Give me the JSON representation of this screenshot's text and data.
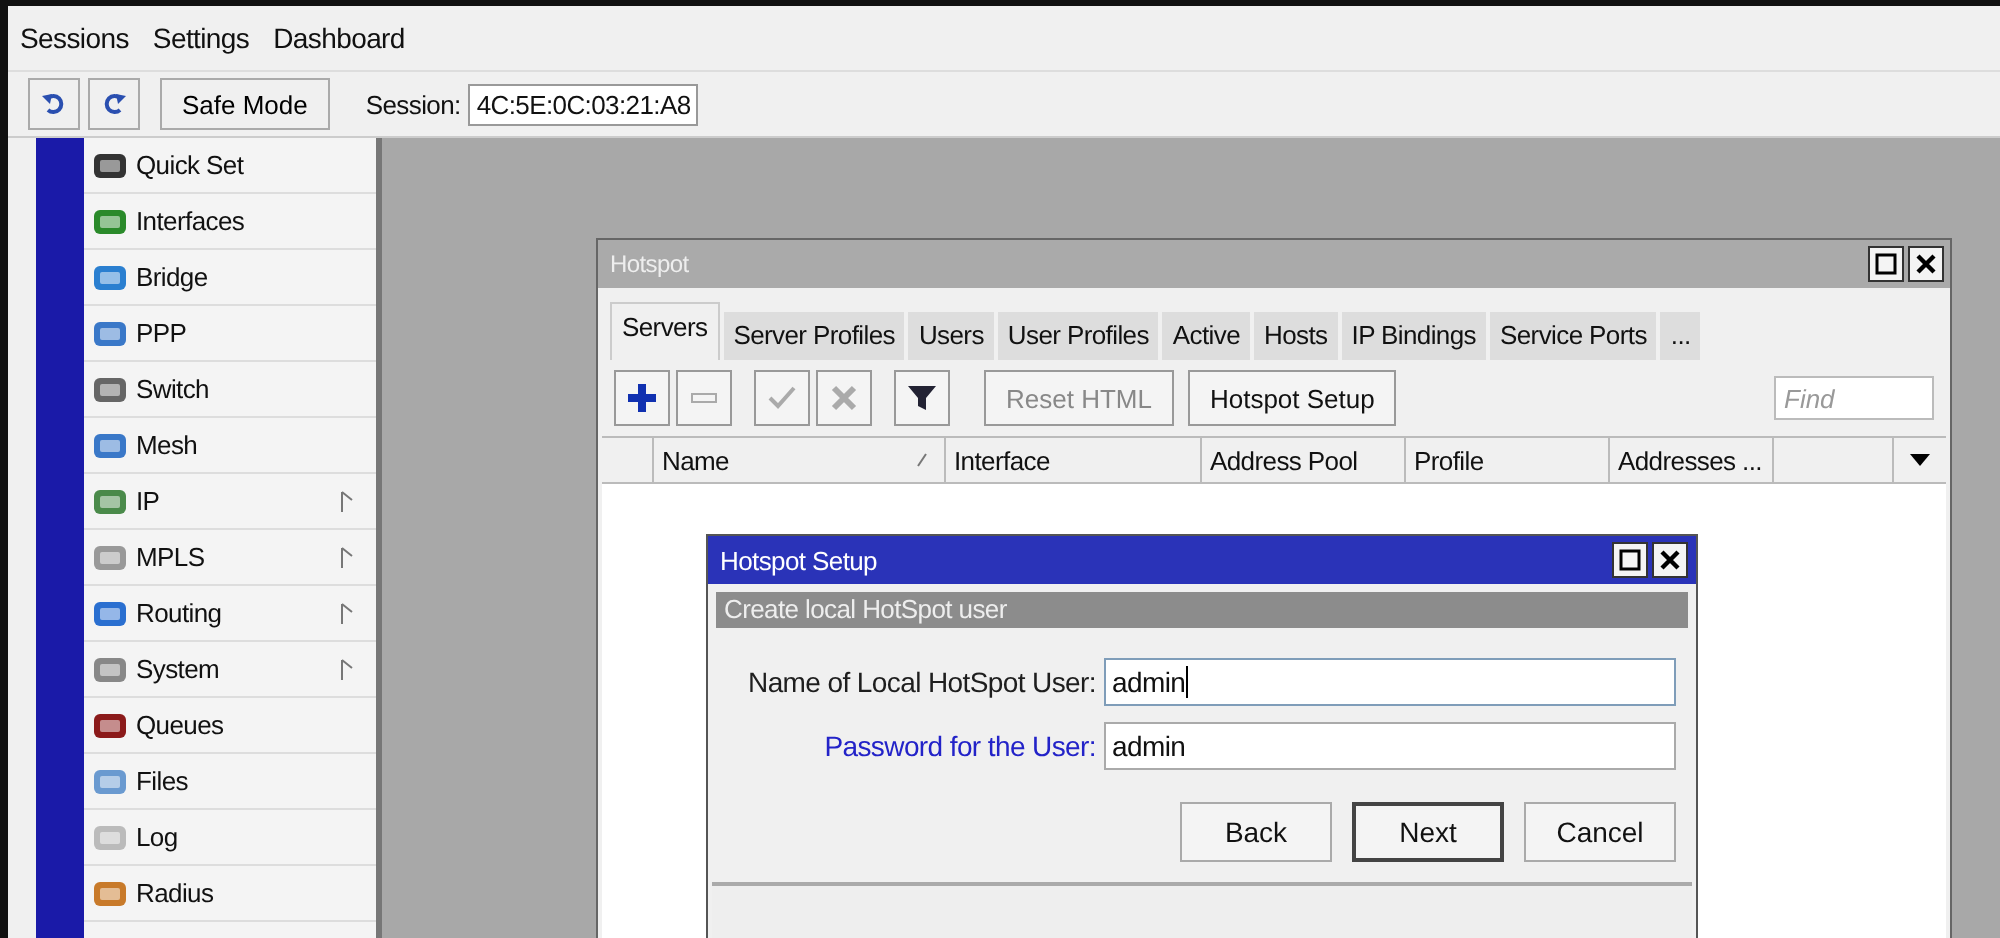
{
  "menu_bar": {
    "items": [
      "Sessions",
      "Settings",
      "Dashboard"
    ]
  },
  "toolbar": {
    "safe_mode": "Safe Mode",
    "session_label": "Session:",
    "session_value": "4C:5E:0C:03:21:A8"
  },
  "sidebar": {
    "items": [
      {
        "label": "Quick Set",
        "has_submenu": false
      },
      {
        "label": "Interfaces",
        "has_submenu": false
      },
      {
        "label": "Bridge",
        "has_submenu": false
      },
      {
        "label": "PPP",
        "has_submenu": false
      },
      {
        "label": "Switch",
        "has_submenu": false
      },
      {
        "label": "Mesh",
        "has_submenu": false
      },
      {
        "label": "IP",
        "has_submenu": true
      },
      {
        "label": "MPLS",
        "has_submenu": true
      },
      {
        "label": "Routing",
        "has_submenu": true
      },
      {
        "label": "System",
        "has_submenu": true
      },
      {
        "label": "Queues",
        "has_submenu": false
      },
      {
        "label": "Files",
        "has_submenu": false
      },
      {
        "label": "Log",
        "has_submenu": false
      },
      {
        "label": "Radius",
        "has_submenu": false
      }
    ]
  },
  "hotspot_window": {
    "title": "Hotspot",
    "tabs": [
      {
        "label": "Servers",
        "selected": true
      },
      {
        "label": "Server Profiles",
        "selected": false
      },
      {
        "label": "Users",
        "selected": false
      },
      {
        "label": "User Profiles",
        "selected": false
      },
      {
        "label": "Active",
        "selected": false
      },
      {
        "label": "Hosts",
        "selected": false
      },
      {
        "label": "IP Bindings",
        "selected": false
      },
      {
        "label": "Service Ports",
        "selected": false
      },
      {
        "label": "...",
        "selected": false
      }
    ],
    "tool_buttons": [
      {
        "kind": "add",
        "disabled": false
      },
      {
        "kind": "remove",
        "disabled": true
      },
      {
        "kind": "enable",
        "disabled": true
      },
      {
        "kind": "disable",
        "disabled": true
      },
      {
        "kind": "filter",
        "disabled": false
      }
    ],
    "text_buttons": [
      {
        "label": "Reset HTML",
        "disabled": true
      },
      {
        "label": "Hotspot Setup",
        "disabled": false
      }
    ],
    "find": {
      "placeholder": "Find"
    },
    "table": {
      "columns": [
        {
          "label": "Name",
          "sorted": true
        },
        {
          "label": "Interface",
          "sorted": false
        },
        {
          "label": "Address Pool",
          "sorted": false
        },
        {
          "label": "Profile",
          "sorted": false
        },
        {
          "label": "Addresses ...",
          "sorted": false
        }
      ]
    }
  },
  "setup_dialog": {
    "title": "Hotspot Setup",
    "subtitle": "Create local HotSpot user",
    "fields": [
      {
        "label": "Name of Local HotSpot User:",
        "value": "admin",
        "color": "#1e1e1e",
        "focused": true
      },
      {
        "label": "Password for the User:",
        "value": "admin",
        "color": "#2323c8",
        "focused": false
      }
    ],
    "buttons": [
      {
        "label": "Back",
        "default": false
      },
      {
        "label": "Next",
        "default": true
      },
      {
        "label": "Cancel",
        "default": false
      }
    ]
  }
}
